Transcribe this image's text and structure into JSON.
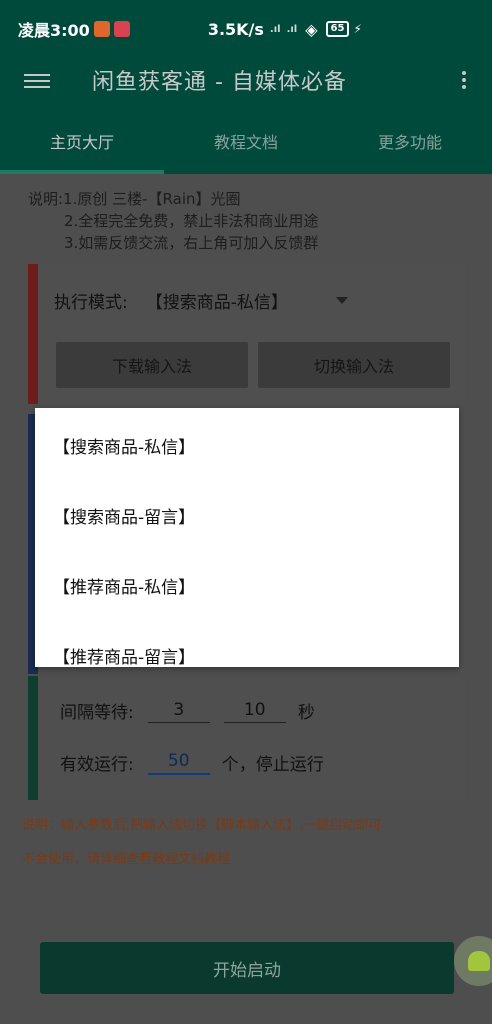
{
  "status_bar": {
    "time": "凌晨3:00",
    "net_speed": "3.5K/s",
    "signal_1": ".ıl",
    "signal_2": ".ıl",
    "battery": "65"
  },
  "app_bar": {
    "title": "闲鱼获客通 - 自媒体必备"
  },
  "tabs": [
    {
      "label": "主页大厅",
      "active": true
    },
    {
      "label": "教程文档",
      "active": false
    },
    {
      "label": "更多功能",
      "active": false
    }
  ],
  "notes": {
    "line1": "说明:1.原创 三楼-【Rain】光圈",
    "line2": "2.全程完全免费，禁止非法和商业用途",
    "line3": "3.如需反馈交流，右上角可加入反馈群"
  },
  "mode": {
    "label": "执行模式:",
    "value": "【搜索商品-私信】"
  },
  "buttons": {
    "download_ime": "下载输入法",
    "switch_ime": "切换输入法",
    "start": "开始启动"
  },
  "interval": {
    "label": "间隔等待:",
    "min": "3",
    "max": "10",
    "unit": "秒"
  },
  "run": {
    "label": "有效运行:",
    "count": "50",
    "suffix": "个，停止运行"
  },
  "warnings": {
    "w1": "说明：输入参数后,把输入法切换【脚本输入法】,一键启动即可",
    "w2": "不会使用，请详细查看教程文档教程"
  },
  "dropdown_options": [
    "【搜索商品-私信】",
    "【搜索商品-留言】",
    "【推荐商品-私信】",
    "【推荐商品-留言】"
  ],
  "colors": {
    "primary": "#004a3c",
    "accent": "#1f7a64"
  }
}
